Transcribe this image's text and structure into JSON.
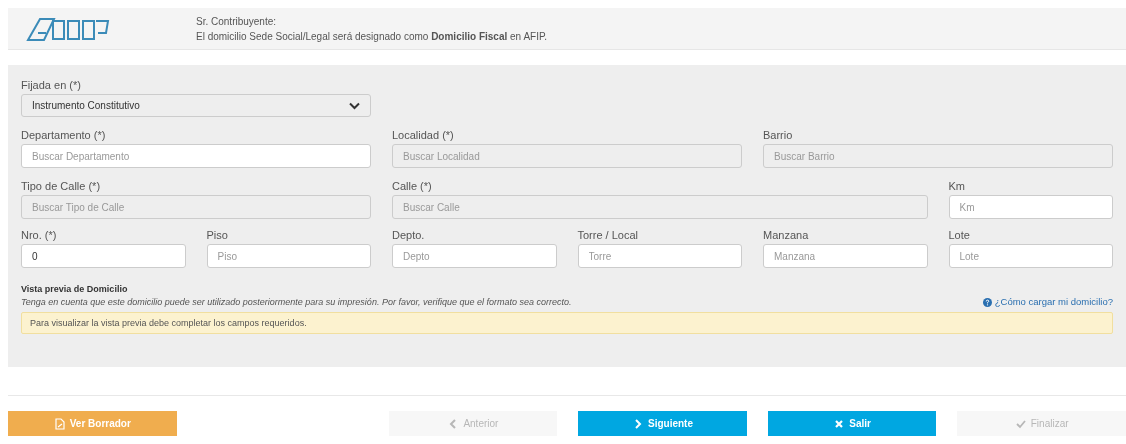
{
  "header": {
    "greeting": "Sr. Contribuyente:",
    "message": "El domicilio Sede Social/Legal será designado como **Domicilio Fiscal** en AFIP."
  },
  "form": {
    "select": {
      "label": "Fijada en (*)",
      "value": "Instrumento Constitutivo"
    },
    "fields": [
      {
        "label": "Departamento (*)",
        "placeholder": "Buscar Departamento",
        "disabled": false
      },
      {
        "label": "Localidad (*)",
        "placeholder": "Buscar Localidad",
        "disabled": true
      },
      {
        "label": "Barrio",
        "placeholder": "Buscar Barrio",
        "disabled": true
      },
      {
        "label": "Tipo de Calle (*)",
        "placeholder": "Buscar Tipo de Calle",
        "disabled": true
      },
      {
        "label": "Calle (*)",
        "placeholder": "Buscar Calle",
        "disabled": true
      },
      {
        "label": "Km",
        "placeholder": "Km",
        "disabled": false
      },
      {
        "label": "Nro. (*)",
        "value": "0",
        "disabled": false
      },
      {
        "label": "Piso",
        "placeholder": "Piso",
        "disabled": false
      },
      {
        "label": "Depto.",
        "placeholder": "Depto",
        "disabled": false
      },
      {
        "label": "Torre / Local",
        "placeholder": "Torre",
        "disabled": false
      },
      {
        "label": "Manzana",
        "placeholder": "Manzana",
        "disabled": false
      },
      {
        "label": "Lote",
        "placeholder": "Lote",
        "disabled": false
      }
    ],
    "preview": {
      "title": "Vista previa de Domicilio",
      "note": "Tenga en cuenta que este domicilio puede ser utilizado posteriormente para su impresión. Por favor, verifique que el formato sea correcto.",
      "help_link": "¿Cómo cargar mi domicilio?",
      "alert": "Para visualizar la vista previa debe completar los campos requeridos."
    }
  },
  "buttons": [
    {
      "label": "Ver Borrador",
      "kind": "draft",
      "disabled": false
    },
    {
      "label": "Anterior",
      "kind": "prev",
      "disabled": true
    },
    {
      "label": "Siguiente",
      "kind": "next",
      "disabled": false
    },
    {
      "label": "Salir",
      "kind": "exit",
      "disabled": false
    },
    {
      "label": "Finalizar",
      "kind": "finish",
      "disabled": true
    }
  ]
}
